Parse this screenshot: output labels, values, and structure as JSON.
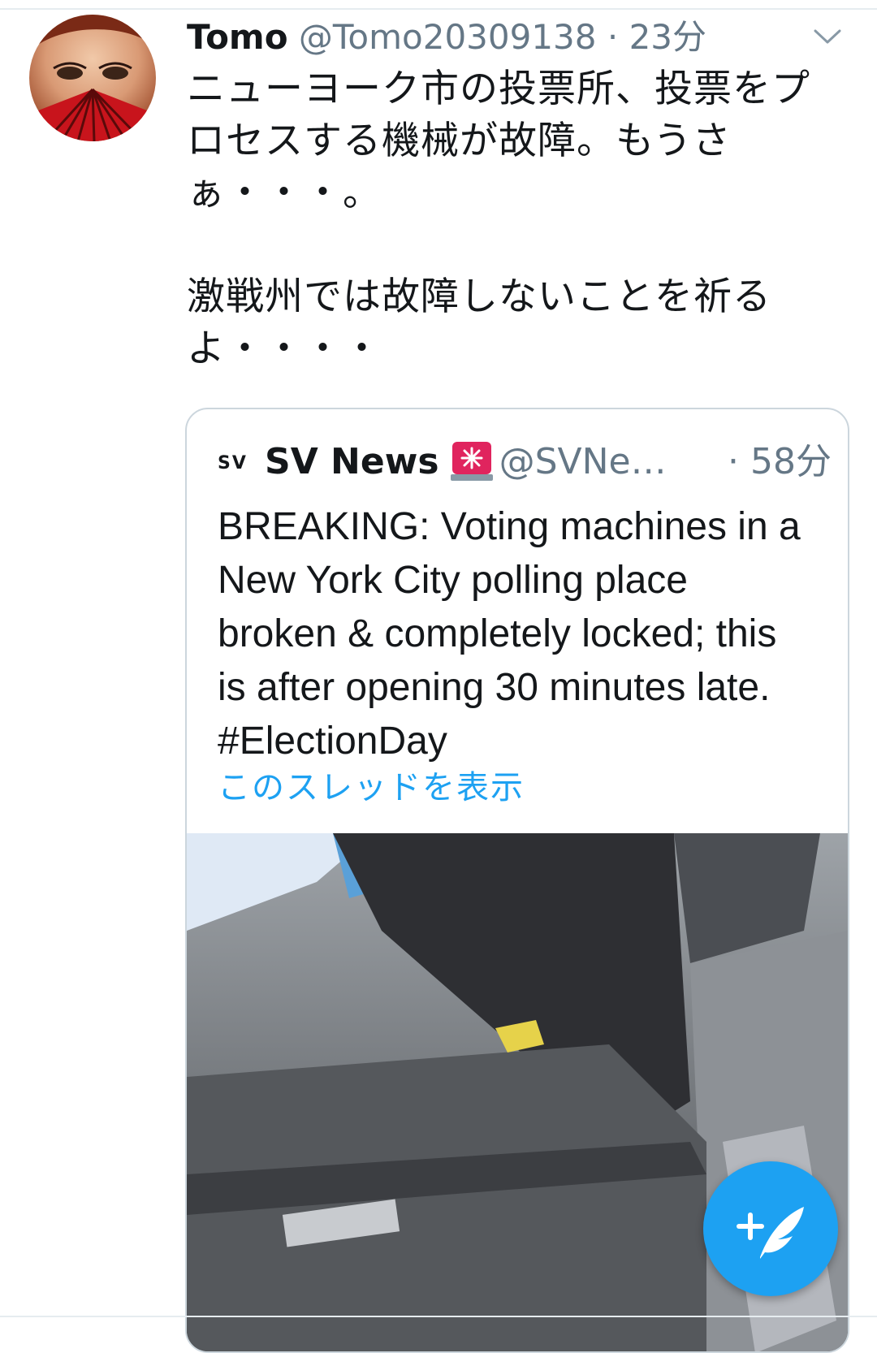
{
  "tweet": {
    "author_name": "Tomo",
    "author_handle": "@Tomo20309138",
    "separator": " · ",
    "time": "23分",
    "text": "ニューヨーク市の投票所、投票をプ\nロセスする機械が故障。もうさ\nぁ・・・。\n\n激戦州では故障しないことを祈る\nよ・・・・"
  },
  "quote": {
    "logo": "SV",
    "name": "SV News",
    "badge_icon": "police-siren-icon",
    "handle": "@SVNe…",
    "time": "· 58分",
    "text": "BREAKING: Voting machines in a\nNew York City polling place\nbroken & completely locked; this\nis after opening 30 minutes late.\n#ElectionDay",
    "thread_link": "このスレッドを表示"
  },
  "icons": {
    "caret": "chevron-down-icon",
    "compose": "compose-tweet-icon"
  },
  "colors": {
    "accent": "#1da1f2",
    "secondary_text": "#657786",
    "border": "#ccd6dd"
  }
}
